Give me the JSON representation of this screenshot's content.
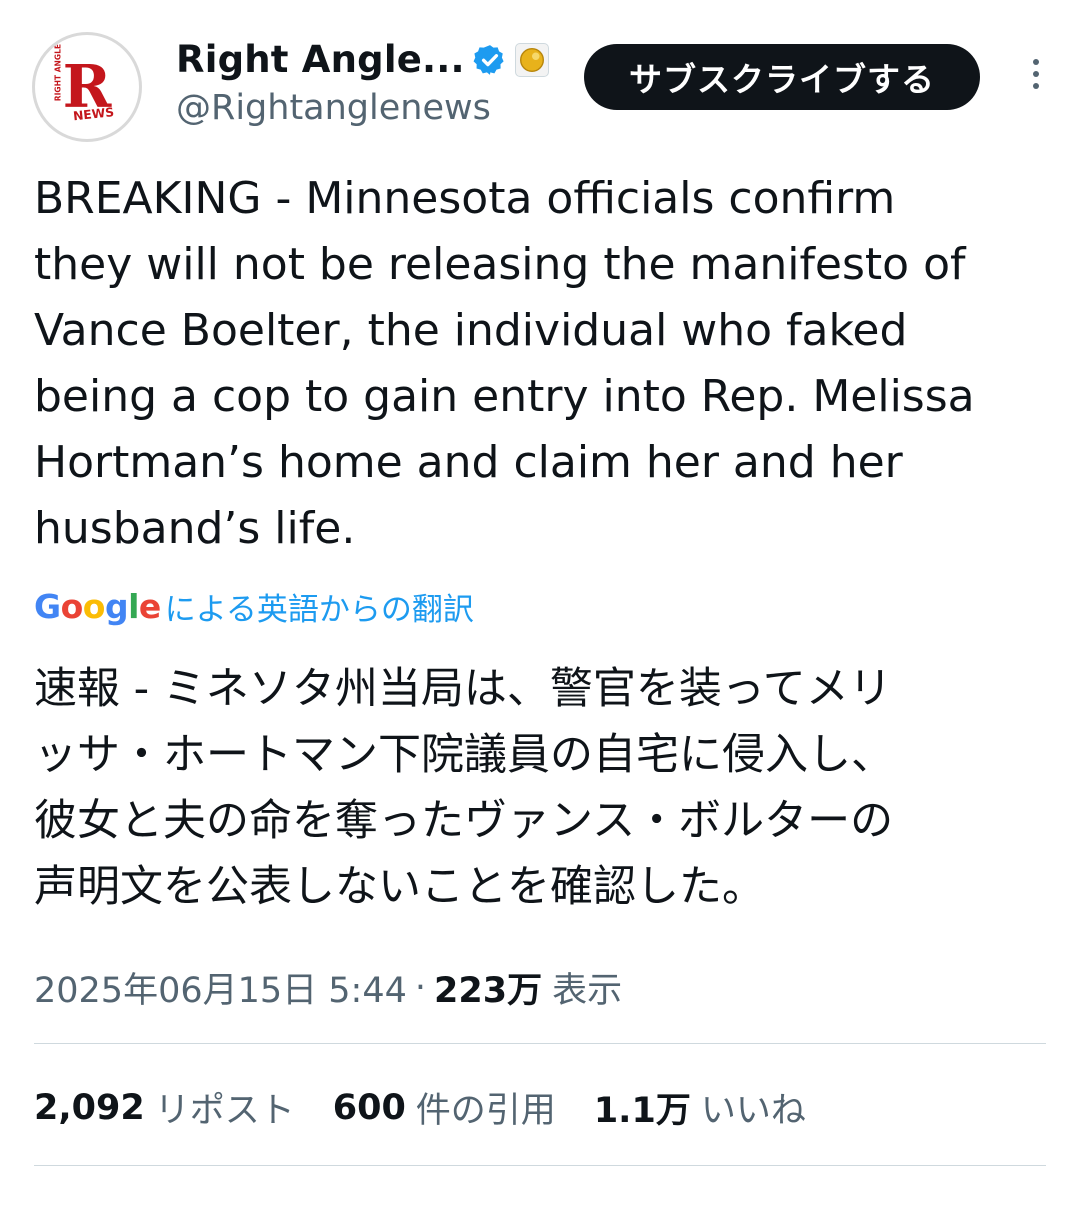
{
  "profile": {
    "avatar_text_top": "RIGHT ANGLE",
    "avatar_letter": "R",
    "avatar_text_bottom": "NEWS",
    "display_name": "Right Angle...",
    "verified_icon": "verified-badge-icon",
    "affiliate_icon": "affiliate-badge-icon",
    "handle": "@Rightanglenews",
    "subscribe_label": "サブスクライブする",
    "more_icon": "more-vertical-icon"
  },
  "tweet": {
    "text": "BREAKING - Minnesota officials confirm\nthey will not be releasing the manifesto of\nVance Boelter, the individual who faked\nbeing a cop to gain entry into Rep. Melissa\nHortman’s home and claim her and her\nhusband’s life."
  },
  "translation": {
    "provider": "Google",
    "label": "による英語からの翻訳",
    "text": "速報 - ミネソタ州当局は、警官を装ってメリ\nッサ・ホートマン下院議員の自宅に侵入し、\n彼女と夫の命を奪ったヴァンス・ボルターの\n声明文を公表しないことを確認した。"
  },
  "meta": {
    "timestamp": "2025年06月15日 5:44",
    "separator": "·",
    "views_count": "223万",
    "views_label": "表示"
  },
  "stats": {
    "reposts_count": "2,092",
    "reposts_label": "リポスト",
    "quotes_count": "600",
    "quotes_label": "件の引用",
    "likes_count": "1.1万",
    "likes_label": "いいね"
  },
  "colors": {
    "accent": "#1d9bf0",
    "text": "#0f1419",
    "secondary": "#536471",
    "brand_red": "#c4161c"
  }
}
